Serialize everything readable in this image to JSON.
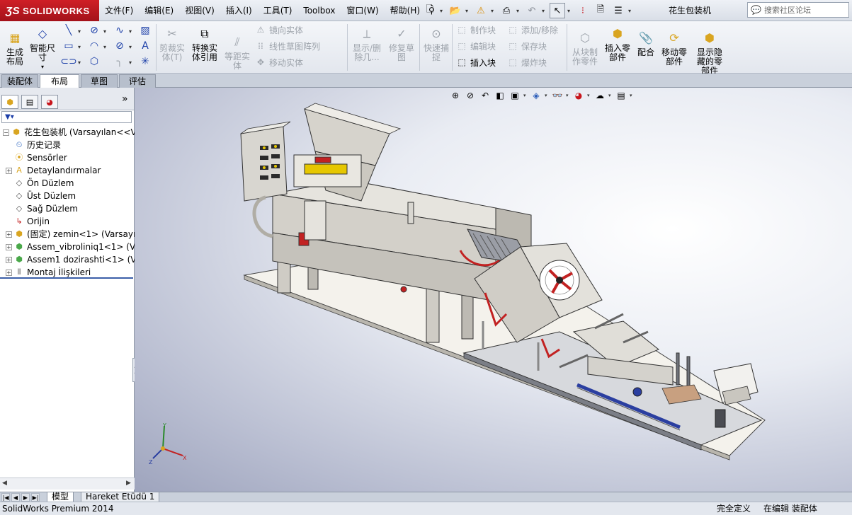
{
  "app": {
    "logo_text": "SOLIDWORKS",
    "document_title": "花生包装机",
    "search_placeholder": "搜索社区论坛"
  },
  "menu": [
    "文件(F)",
    "编辑(E)",
    "视图(V)",
    "插入(I)",
    "工具(T)",
    "Toolbox",
    "窗口(W)",
    "帮助(H)"
  ],
  "ribbon": {
    "generate_layout": "生成\n布局",
    "smart_dimension": "智能尺\n寸",
    "trim_entities": "剪裁实\n体(T)",
    "convert_entities": "转换实\n体引用",
    "offset_entities": "等距实\n体",
    "mirror_entities": "镜向实体",
    "linear_pattern": "线性草图阵列",
    "move_entities": "移动实体",
    "show_delete_relations": "显示/删\n除几...",
    "repair_sketch": "修复草\n图",
    "quick_snaps": "快速捕\n捉",
    "make_block": "制作块",
    "edit_block": "编辑块",
    "insert_block": "插入块",
    "add_remove": "添加/移除",
    "save_block": "保存块",
    "explode_block": "爆炸块",
    "make_part_from_block": "从块制\n作零件",
    "insert_components": "插入零\n部件",
    "mate": "配合",
    "move_component": "移动零\n部件",
    "show_hidden_components": "显示隐\n藏的零\n部件"
  },
  "tabs": [
    "装配体",
    "布局",
    "草图",
    "评估"
  ],
  "active_tab": 1,
  "tree": {
    "root": "花生包装机  (Varsayılan<<Va",
    "items": [
      {
        "label": "历史记录",
        "icon": "history-icon",
        "expandable": false
      },
      {
        "label": "Sensörler",
        "icon": "sensor-icon",
        "expandable": false
      },
      {
        "label": "Detaylandırmalar",
        "icon": "annotation-icon",
        "expandable": true
      },
      {
        "label": "Ön Düzlem",
        "icon": "plane-icon",
        "expandable": false
      },
      {
        "label": "Üst Düzlem",
        "icon": "plane-icon",
        "expandable": false
      },
      {
        "label": "Sağ Düzlem",
        "icon": "plane-icon",
        "expandable": false
      },
      {
        "label": "Orijin",
        "icon": "origin-icon",
        "expandable": false
      },
      {
        "label": "(固定) zemin<1> (Varsayı",
        "icon": "part-icon",
        "expandable": true
      },
      {
        "label": "Assem_vibroliniq1<1> (V",
        "icon": "subassembly-icon",
        "expandable": true
      },
      {
        "label": "Assem1 dozirashti<1> (V",
        "icon": "subassembly-icon",
        "expandable": true
      },
      {
        "label": "Montaj İlişkileri",
        "icon": "mates-icon",
        "expandable": true
      }
    ]
  },
  "bottom_tabs": [
    "模型",
    "Hareket Etüdü 1"
  ],
  "status": {
    "app_name": "SolidWorks Premium 2014",
    "definition": "完全定义",
    "editing": "在编辑 装配体"
  },
  "colors": {
    "logo_red": "#c8161d",
    "accent_blue": "#1c3fa8",
    "machine_gray": "#c9c6bf",
    "machine_red": "#c22222",
    "conveyor_blue": "#2b3fa0"
  }
}
